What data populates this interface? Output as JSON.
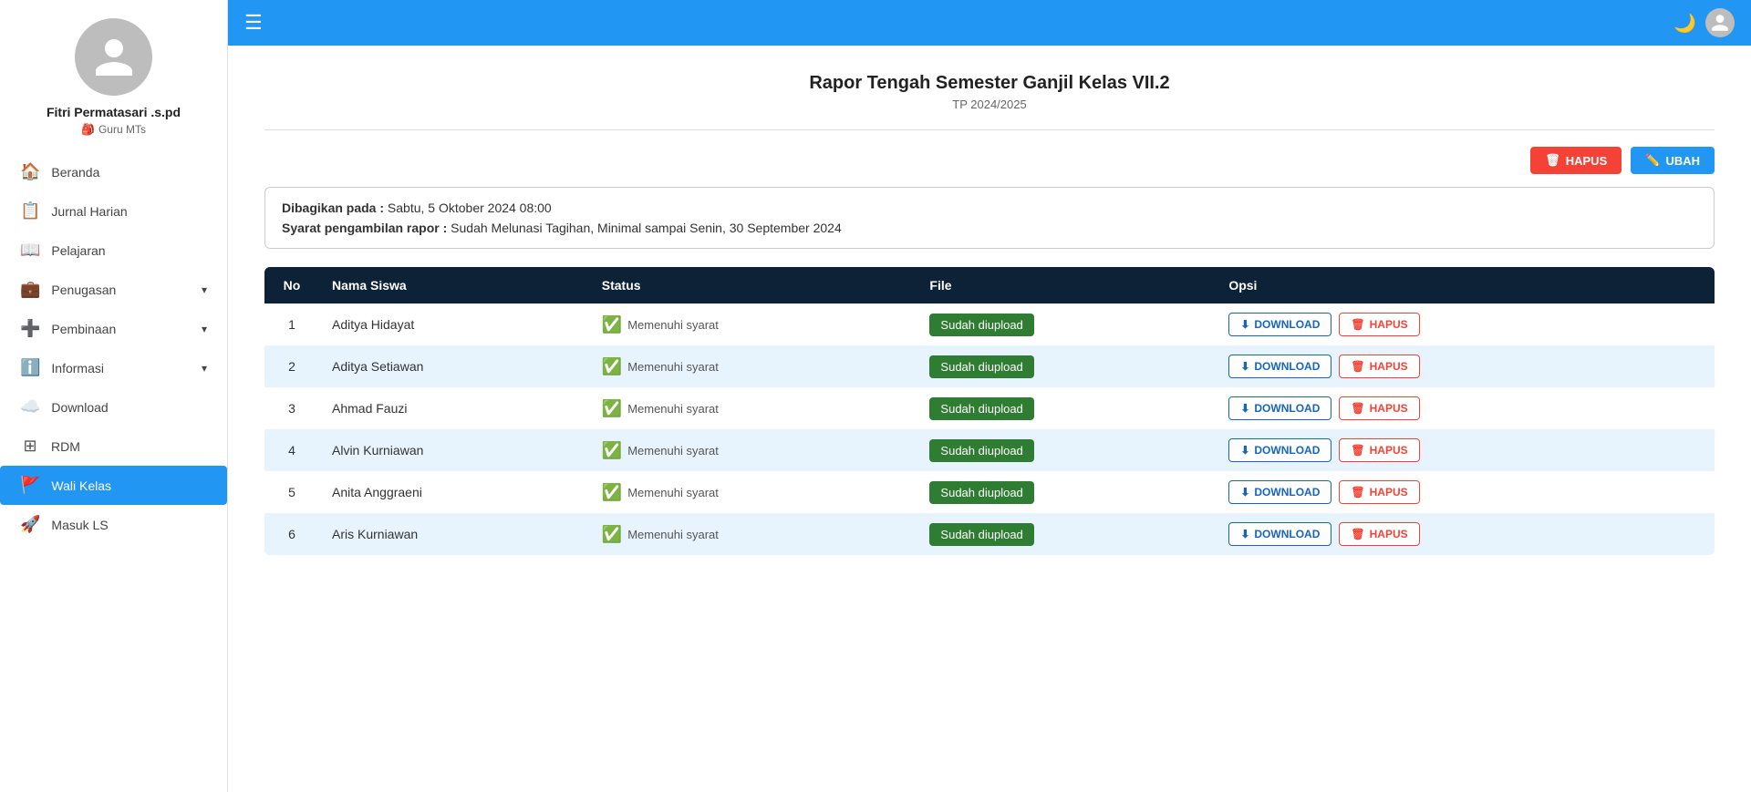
{
  "sidebar": {
    "user": {
      "name": "Fitri Permatasari .s.pd",
      "role": "Guru MTs"
    },
    "nav_items": [
      {
        "id": "beranda",
        "label": "Beranda",
        "icon": "home",
        "active": false,
        "has_sub": false
      },
      {
        "id": "jurnal-harian",
        "label": "Jurnal Harian",
        "icon": "list-alt",
        "active": false,
        "has_sub": false
      },
      {
        "id": "pelajaran",
        "label": "Pelajaran",
        "icon": "book",
        "active": false,
        "has_sub": false
      },
      {
        "id": "penugasan",
        "label": "Penugasan",
        "icon": "briefcase",
        "active": false,
        "has_sub": true
      },
      {
        "id": "pembinaan",
        "label": "Pembinaan",
        "icon": "plus-square",
        "active": false,
        "has_sub": true
      },
      {
        "id": "informasi",
        "label": "Informasi",
        "icon": "info-circle",
        "active": false,
        "has_sub": true
      },
      {
        "id": "download",
        "label": "Download",
        "icon": "cloud-download",
        "active": false,
        "has_sub": false
      },
      {
        "id": "rdm",
        "label": "RDM",
        "icon": "grid",
        "active": false,
        "has_sub": false
      },
      {
        "id": "wali-kelas",
        "label": "Wali Kelas",
        "icon": "flag",
        "active": true,
        "has_sub": false
      },
      {
        "id": "masuk-ls",
        "label": "Masuk LS",
        "icon": "rocket",
        "active": false,
        "has_sub": false
      }
    ]
  },
  "topbar": {
    "hamburger_label": "☰",
    "dark_mode_icon": "🌙",
    "user_icon": "👤"
  },
  "page": {
    "title": "Rapor Tengah Semester Ganjil Kelas VII.2",
    "subtitle": "TP 2024/2025",
    "hapus_label": "HAPUS",
    "ubah_label": "UBAH",
    "info": {
      "dibagikan_label": "Dibagikan pada :",
      "dibagikan_value": "Sabtu, 5 Oktober 2024 08:00",
      "syarat_label": "Syarat pengambilan rapor :",
      "syarat_value": "Sudah Melunasi Tagihan, Minimal sampai Senin, 30 September 2024"
    },
    "table": {
      "headers": [
        "No",
        "Nama Siswa",
        "Status",
        "File",
        "Opsi"
      ],
      "download_label": "DOWNLOAD",
      "hapus_row_label": "HAPUS",
      "badge_label": "Sudah diupload",
      "status_text": "Memenuhi syarat",
      "rows": [
        {
          "no": 1,
          "nama": "Aditya Hidayat"
        },
        {
          "no": 2,
          "nama": "Aditya Setiawan"
        },
        {
          "no": 3,
          "nama": "Ahmad Fauzi"
        },
        {
          "no": 4,
          "nama": "Alvin Kurniawan"
        },
        {
          "no": 5,
          "nama": "Anita Anggraeni"
        },
        {
          "no": 6,
          "nama": "Aris Kurniawan"
        }
      ]
    }
  }
}
